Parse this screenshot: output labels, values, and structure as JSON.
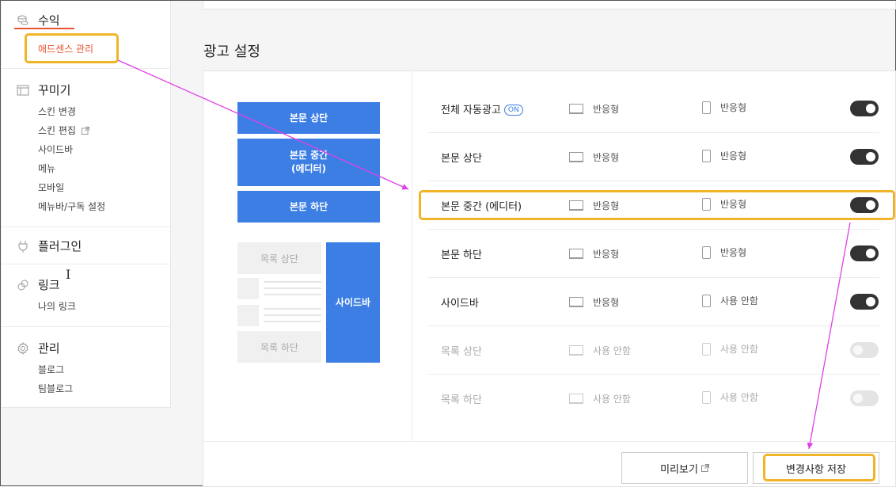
{
  "sidebar": {
    "sections": [
      {
        "label": "수익",
        "icon": "coins-icon",
        "items": [
          "애드센스 관리"
        ]
      },
      {
        "label": "꾸미기",
        "icon": "layout-icon",
        "items": [
          "스킨 변경",
          "스킨 편집",
          "사이드바",
          "메뉴",
          "모바일",
          "메뉴바/구독 설정"
        ]
      },
      {
        "label": "플러그인",
        "icon": "plug-icon",
        "items": []
      },
      {
        "label": "링크",
        "icon": "link-icon",
        "items": [
          "나의 링크"
        ]
      },
      {
        "label": "관리",
        "icon": "gear-icon",
        "items": [
          "블로그",
          "팀블로그"
        ]
      }
    ]
  },
  "main": {
    "title": "광고 설정",
    "layout_preview": {
      "top": "본문 상단",
      "middle_line1": "본문 중간",
      "middle_line2": "(에디터)",
      "bottom": "본문 하단",
      "list_top": "목록 상단",
      "list_bottom": "목록 하단",
      "sidebar": "사이드바"
    },
    "rows": [
      {
        "name": "전체 자동광고",
        "badge": "ON",
        "pc": "반응형",
        "mobile": "반응형",
        "enabled": true
      },
      {
        "name": "본문 상단",
        "pc": "반응형",
        "mobile": "반응형",
        "enabled": true
      },
      {
        "name": "본문 중간 (에디터)",
        "pc": "반응형",
        "mobile": "반응형",
        "enabled": true
      },
      {
        "name": "본문 하단",
        "pc": "반응형",
        "mobile": "반응형",
        "enabled": true
      },
      {
        "name": "사이드바",
        "pc": "반응형",
        "mobile": "사용 안함",
        "enabled": true
      },
      {
        "name": "목록 상단",
        "pc": "사용 안함",
        "mobile": "사용 안함",
        "enabled": false
      },
      {
        "name": "목록 하단",
        "pc": "사용 안함",
        "mobile": "사용 안함",
        "enabled": false
      }
    ],
    "buttons": {
      "preview": "미리보기",
      "save": "변경사항 저장"
    }
  },
  "colors": {
    "accent": "#3d7ee4",
    "active_red": "#e8542f",
    "highlight": "#f0b429",
    "arrow": "#e040e8",
    "toggle_on": "#333333"
  }
}
